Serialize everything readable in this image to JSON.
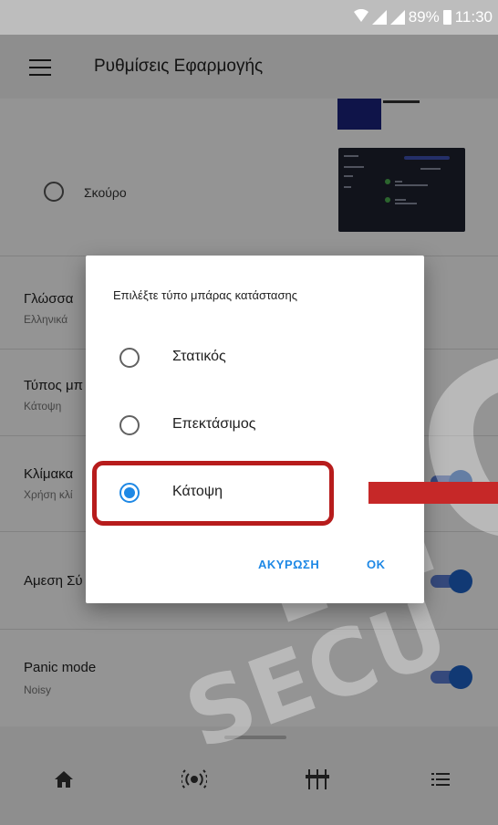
{
  "status_bar": {
    "battery": "89%",
    "time": "11:30"
  },
  "app_bar": {
    "title": "Ρυθμίσεις Εφαρμογής"
  },
  "theme_option": {
    "label": "Σκούρο"
  },
  "settings": [
    {
      "title": "Γλώσσα",
      "subtitle": "Ελληνικά"
    },
    {
      "title": "Τύπος μπ",
      "subtitle": "Κάτοψη"
    },
    {
      "title": "Κλίμακα",
      "subtitle": "Χρήση κλί"
    },
    {
      "title": "Αμεση Σύ",
      "subtitle": ""
    },
    {
      "title": "Panic mode",
      "subtitle": "Noisy"
    }
  ],
  "dialog": {
    "title": "Επιλέξτε τύπο μπάρας κατάστασης",
    "options": [
      "Στατικός",
      "Επεκτάσιμος",
      "Κάτοψη"
    ],
    "selected_index": 2,
    "cancel_label": "ΑΚΥΡΩΣΗ",
    "ok_label": "OK"
  },
  "bottom_nav": {
    "icons": [
      "home-icon",
      "sensor-icon",
      "equalizer-icon",
      "list-icon"
    ]
  },
  "watermark": {
    "text_large": "NO",
    "text_small": "SECU"
  },
  "colors": {
    "accent": "#1e88e5",
    "highlight": "#b71c1c",
    "toggle": "#1e63c9"
  }
}
